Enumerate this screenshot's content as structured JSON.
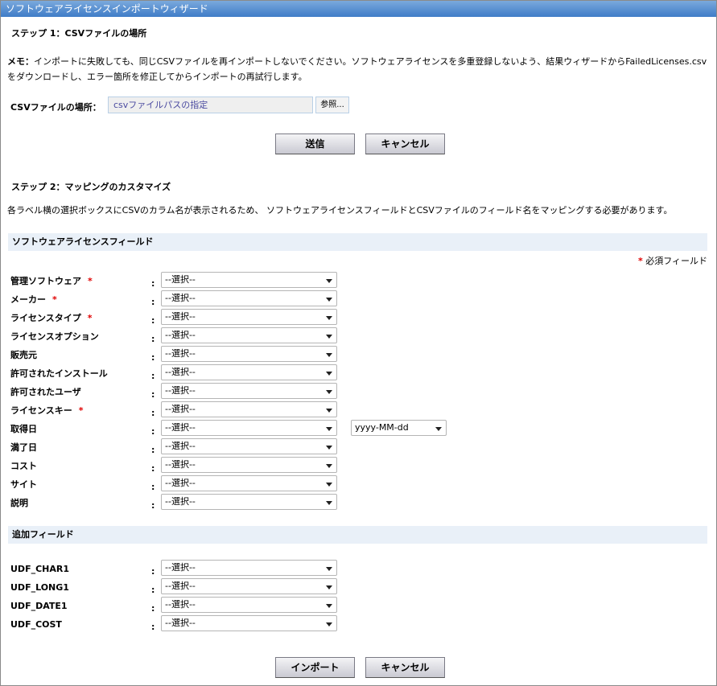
{
  "title": "ソフトウェアライセンスインポートウィザード",
  "step1": {
    "heading": "ステップ 1：CSVファイルの場所",
    "memo_label": "メモ：",
    "memo_line1": "インポートに失敗しても、同じCSVファイルを再インポートしないでください。ソフトウェアライセンスを多重登録しないよう、結果ウィザードからFailedLicenses.csv",
    "memo_line2": "をダウンロードし、エラー箇所を修正してからインポートの再試行します。",
    "file_label": "CSVファイルの場所：",
    "file_placeholder": "csvファイルパスの指定",
    "browse": "参照...",
    "submit": "送信",
    "cancel": "キャンセル"
  },
  "step2": {
    "heading": "ステップ 2：マッピングのカスタマイズ",
    "description": "各ラベル横の選択ボックスにCSVのカラム名が表示されるため、 ソフトウェアライセンスフィールドとCSVファイルのフィールド名をマッピングする必要があります。"
  },
  "license_section": {
    "title": "ソフトウェアライセンスフィールド",
    "required_star": "*",
    "required_note": "必須フィールド",
    "fields": [
      {
        "label": "管理ソフトウェア",
        "required": true,
        "value": "--選択--"
      },
      {
        "label": "メーカー",
        "required": true,
        "value": "--選択--"
      },
      {
        "label": "ライセンスタイプ",
        "required": true,
        "value": "--選択--"
      },
      {
        "label": "ライセンスオプション",
        "required": false,
        "value": "--選択--"
      },
      {
        "label": "販売元",
        "required": false,
        "value": "--選択--"
      },
      {
        "label": "許可されたインストール",
        "required": false,
        "value": "--選択--"
      },
      {
        "label": "許可されたユーザ",
        "required": false,
        "value": "--選択--"
      },
      {
        "label": "ライセンスキー",
        "required": true,
        "value": "--選択--"
      },
      {
        "label": "取得日",
        "required": false,
        "value": "--選択--"
      },
      {
        "label": "満了日",
        "required": false,
        "value": "--選択--"
      },
      {
        "label": "コスト",
        "required": false,
        "value": "--選択--"
      },
      {
        "label": "サイト",
        "required": false,
        "value": "--選択--"
      },
      {
        "label": "説明",
        "required": false,
        "value": "--選択--"
      }
    ],
    "date_format": "yyyy-MM-dd"
  },
  "extra_section": {
    "title": "追加フィールド",
    "fields": [
      {
        "label": "UDF_CHAR1",
        "value": "--選択--"
      },
      {
        "label": "UDF_LONG1",
        "value": "--選択--"
      },
      {
        "label": "UDF_DATE1",
        "value": "--選択--"
      },
      {
        "label": "UDF_COST",
        "value": "--選択--"
      }
    ]
  },
  "colon": ":",
  "footer": {
    "import": "インポート",
    "cancel": "キャンセル"
  }
}
